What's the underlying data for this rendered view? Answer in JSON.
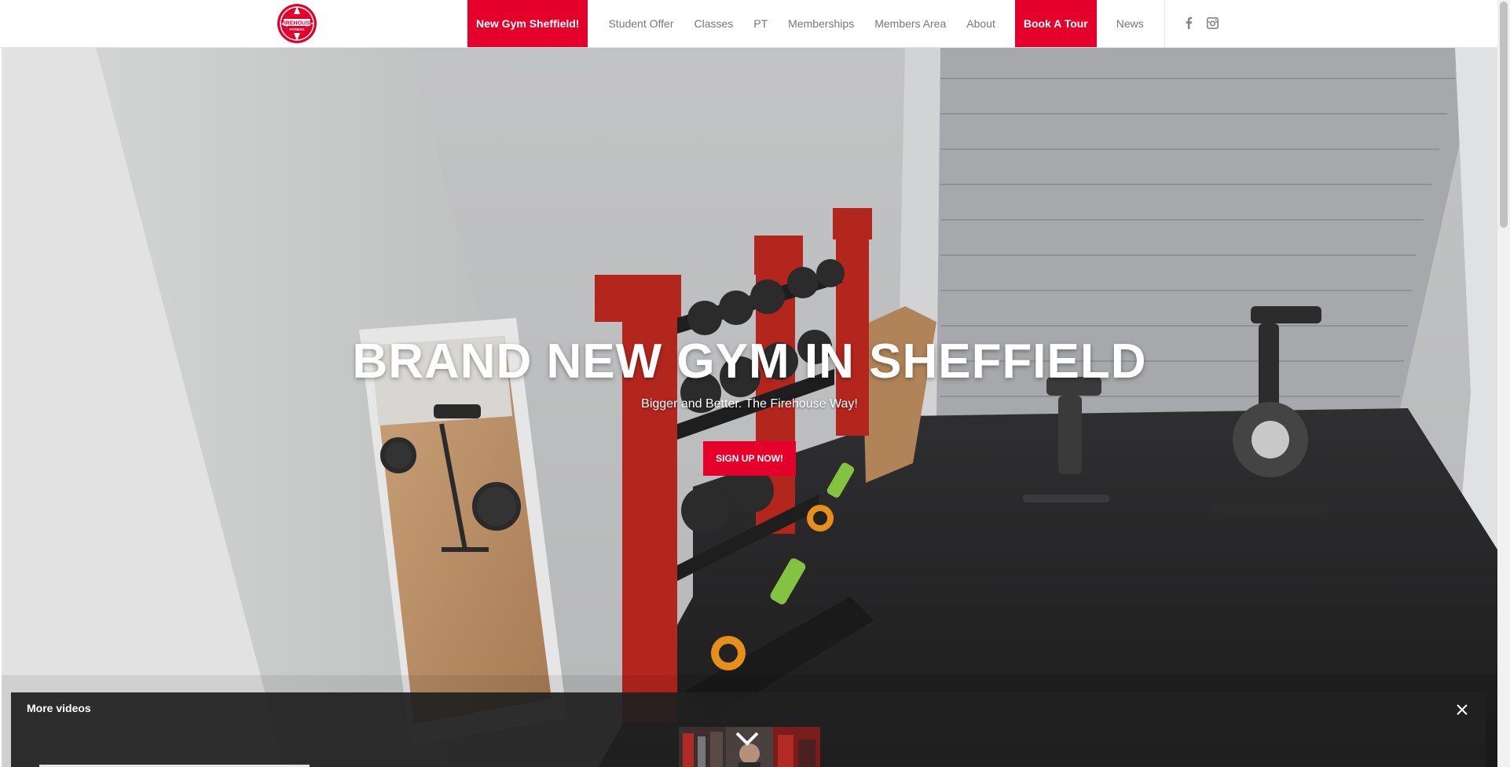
{
  "header": {
    "logo_text_top": "FIREHOUSE",
    "logo_text_bottom": "FITNESS",
    "nav": [
      {
        "label": "New Gym Sheffield!"
      },
      {
        "label": "Student Offer"
      },
      {
        "label": "Classes"
      },
      {
        "label": "PT"
      },
      {
        "label": "Memberships"
      },
      {
        "label": "Members Area"
      },
      {
        "label": "About"
      },
      {
        "label": "Book A Tour"
      },
      {
        "label": "News"
      }
    ],
    "social": [
      {
        "icon": "facebook-icon"
      },
      {
        "icon": "instagram-icon"
      }
    ]
  },
  "hero": {
    "title": "BRAND NEW GYM IN SHEFFIELD",
    "subtitle": "Bigger and Better. The Firehouse Way!",
    "cta": "SIGN UP NOW!"
  },
  "more_videos": {
    "title": "More videos"
  },
  "colors": {
    "accent": "#e4002b",
    "nav_text": "#777777",
    "overlay": "#202020"
  }
}
